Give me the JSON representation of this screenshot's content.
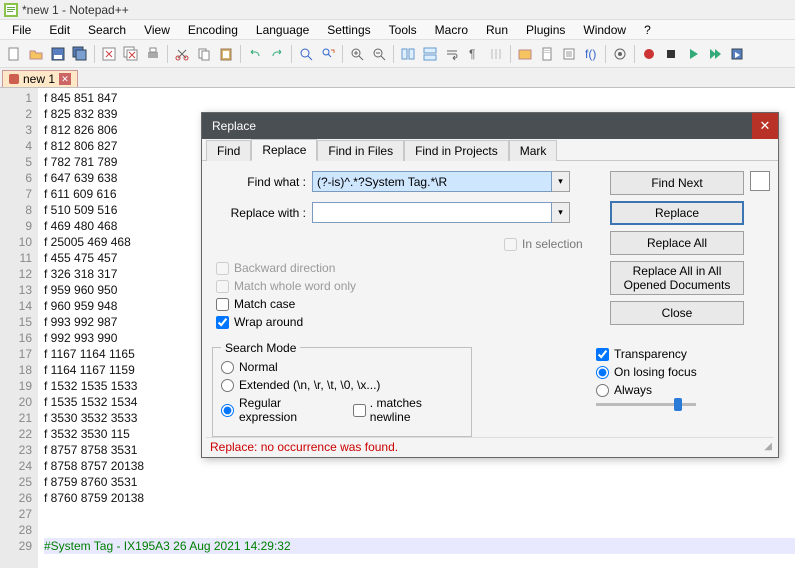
{
  "window": {
    "title": "*new 1 - Notepad++"
  },
  "menubar": [
    "File",
    "Edit",
    "Search",
    "View",
    "Encoding",
    "Language",
    "Settings",
    "Tools",
    "Macro",
    "Run",
    "Plugins",
    "Window",
    "?"
  ],
  "tabbar": {
    "tabs": [
      {
        "label": "new 1"
      }
    ]
  },
  "editor": {
    "lines": [
      "f 845 851 847",
      "f 825 832 839",
      "f 812 826 806",
      "f 812 806 827",
      "f 782 781 789",
      "f 647 639 638",
      "f 611 609 616",
      "f 510 509 516",
      "f 469 480 468",
      "f 25005 469 468",
      "f 455 475 457",
      "f 326 318 317",
      "f 959 960 950",
      "f 960 959 948",
      "f 993 992 987",
      "f 992 993 990",
      "f 1167 1164 1165",
      "f 1164 1167 1159",
      "f 1532 1535 1533",
      "f 1535 1532 1534",
      "f 3530 3532 3533",
      "f 3532 3530 115",
      "f 8757 8758 3531",
      "f 8758 8757 20138",
      "f 8759 8760 3531",
      "f 8760 8759 20138",
      "",
      "",
      "#System Tag - IX195A3 26 Aug 2021 14:29:32"
    ]
  },
  "dialog": {
    "title": "Replace",
    "tabs": [
      "Find",
      "Replace",
      "Find in Files",
      "Find in Projects",
      "Mark"
    ],
    "active_tab": "Replace",
    "find_label": "Find what :",
    "replace_label": "Replace with :",
    "find_value": "(?-is)^.*?System Tag.*\\R",
    "replace_value": "",
    "in_selection_label": "In selection",
    "backward_label": "Backward direction",
    "whole_word_label": "Match whole word only",
    "match_case_label": "Match case",
    "wrap_around_label": "Wrap around",
    "wrap_around_checked": true,
    "search_mode_legend": "Search Mode",
    "sm_normal": "Normal",
    "sm_extended": "Extended (\\n, \\r, \\t, \\0, \\x...)",
    "sm_regex": "Regular expression",
    "sm_dot_newline": ". matches newline",
    "sm_selected": "regex",
    "transparency_label": "Transparency",
    "transparency_checked": true,
    "tr_on_losing": "On losing focus",
    "tr_always": "Always",
    "tr_selected": "on_losing",
    "buttons": {
      "find_next": "Find Next",
      "replace": "Replace",
      "replace_all": "Replace All",
      "replace_all_opened": "Replace All in All Opened Documents",
      "close": "Close"
    },
    "status": "Replace: no occurrence was found."
  }
}
